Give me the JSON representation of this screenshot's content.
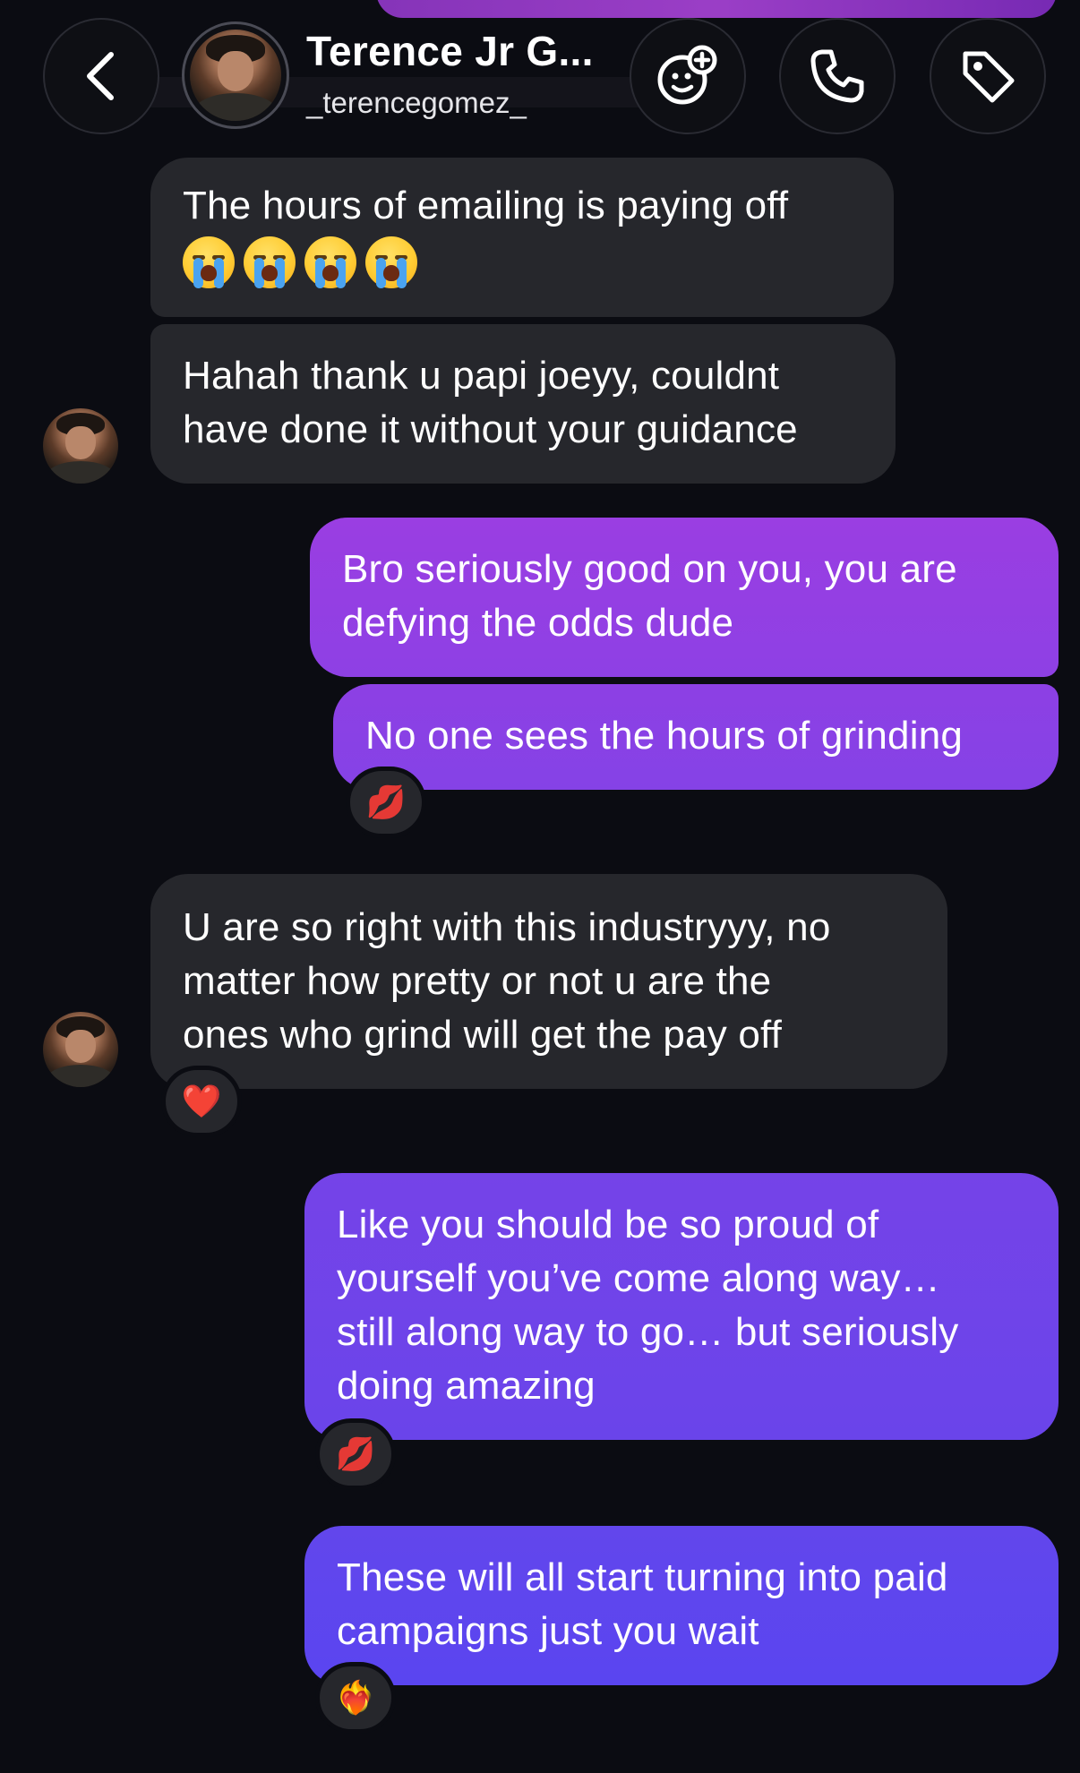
{
  "header": {
    "title": "Terence Jr G...",
    "username": "_terencegomez_",
    "icons": {
      "back": "chevron-left-icon",
      "effects": "sticker-face-plus-icon",
      "call": "phone-icon",
      "tag": "tag-icon"
    }
  },
  "colors": {
    "background": "#0b0c12",
    "incoming_bubble": "#26272c",
    "outgoing_top": "#8b3fe0",
    "outgoing_bottom": "#5a45f0",
    "accent": "#a13ee2"
  },
  "messages": [
    {
      "id": "m1",
      "direction": "incoming",
      "lines": [
        "The hours of emailing is paying off"
      ],
      "emoji": [
        "loudly-crying-face",
        "loudly-crying-face",
        "loudly-crying-face",
        "loudly-crying-face"
      ]
    },
    {
      "id": "m2",
      "direction": "incoming",
      "lines": [
        "Hahah thank u papi joeyy, couldnt",
        "have done it without your guidance"
      ]
    },
    {
      "id": "m3",
      "direction": "outgoing",
      "lines": [
        "Bro seriously good on you, you are",
        "defying the odds dude"
      ]
    },
    {
      "id": "m4",
      "direction": "outgoing",
      "lines": [
        "No one sees the hours of grinding"
      ],
      "reaction": "💋"
    },
    {
      "id": "m5",
      "direction": "incoming",
      "lines": [
        "U are so right with this industryyy, no",
        "matter how pretty or not u are the",
        "ones who grind will get the pay off"
      ],
      "reaction": "❤️"
    },
    {
      "id": "m6",
      "direction": "outgoing",
      "lines": [
        "Like you should be so proud of",
        "yourself you’ve come along way…",
        "still along way to go… but seriously",
        "doing amazing"
      ],
      "reaction": "💋"
    },
    {
      "id": "m7",
      "direction": "outgoing",
      "lines": [
        "These will all start turning into paid",
        "campaigns just you wait"
      ],
      "reaction": "❤️‍🔥"
    }
  ]
}
